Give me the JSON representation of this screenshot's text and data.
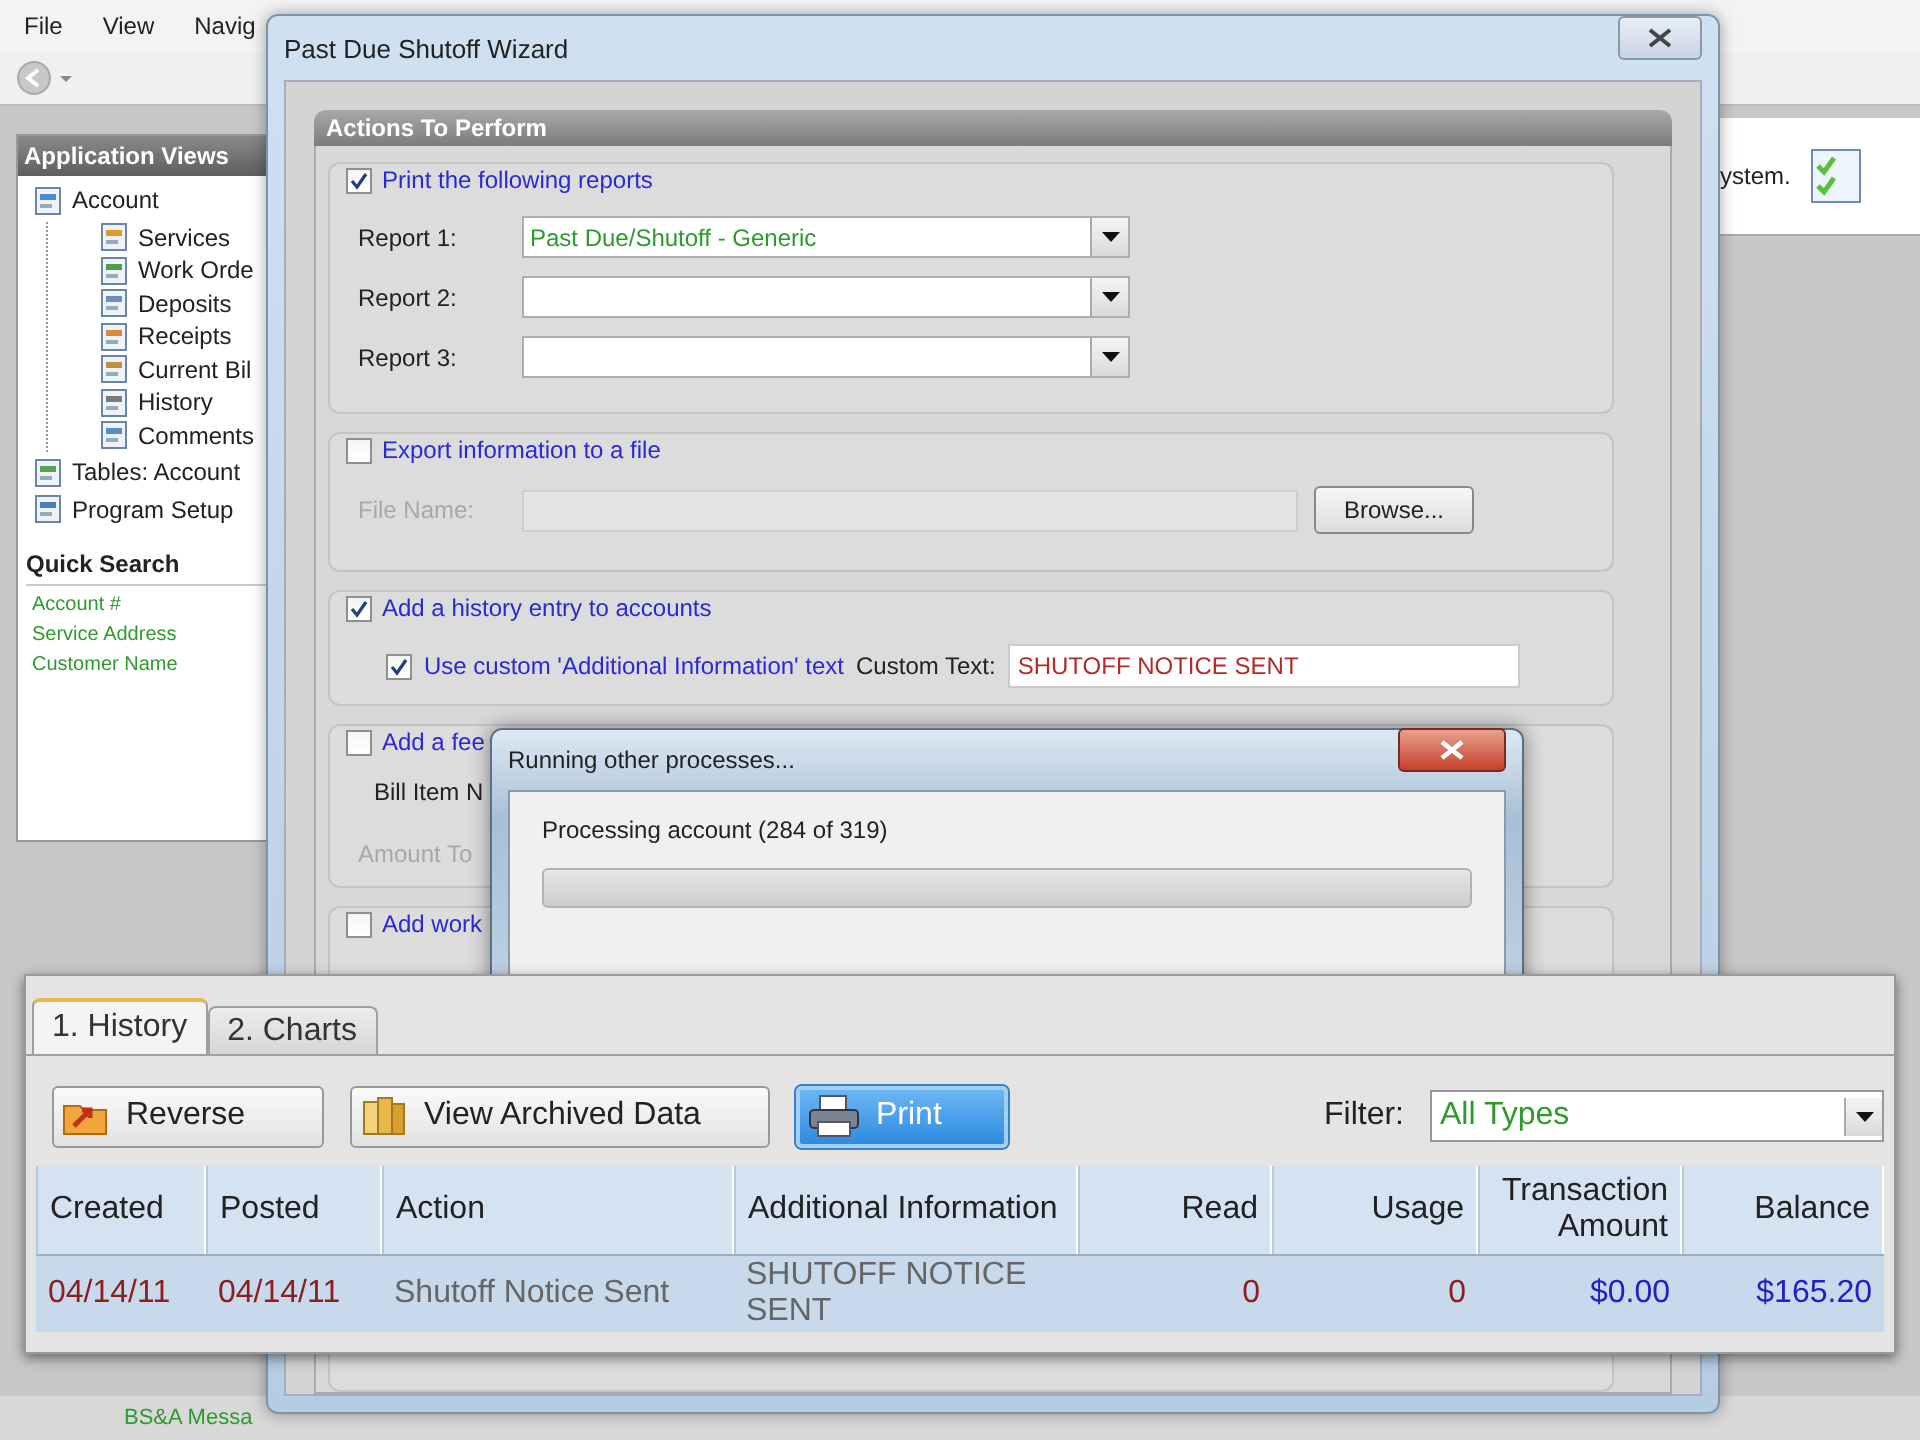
{
  "app": {
    "menu": [
      "File",
      "View",
      "Navig"
    ],
    "sidebar": {
      "title": "Application Views",
      "tree": [
        {
          "label": "Account",
          "children": [
            {
              "label": "Services"
            },
            {
              "label": "Work Orde"
            },
            {
              "label": "Deposits"
            },
            {
              "label": "Receipts"
            },
            {
              "label": "Current Bil"
            },
            {
              "label": "History"
            },
            {
              "label": "Comments"
            }
          ]
        },
        {
          "label": "Tables: Account"
        },
        {
          "label": "Program Setup"
        }
      ]
    },
    "quick_search": {
      "title": "Quick Search",
      "links": [
        "Account #",
        "Service Address",
        "Customer Name"
      ]
    },
    "info_text": "ystem.",
    "status_text": "BS&A Messa"
  },
  "wizard": {
    "title": "Past Due Shutoff Wizard",
    "section": "Actions To Perform",
    "print_group": {
      "label": "Print the following reports",
      "checked": true,
      "reports": [
        {
          "label": "Report 1:",
          "value": "Past Due/Shutoff - Generic"
        },
        {
          "label": "Report 2:"
        },
        {
          "label": "Report 3:"
        }
      ]
    },
    "export_group": {
      "label": "Export information to a file",
      "checked": false,
      "file_label": "File Name:",
      "browse": "Browse..."
    },
    "history_group": {
      "label": "Add a history entry to accounts",
      "checked": true,
      "custom_label": "Use custom 'Additional Information' text",
      "custom_checked": true,
      "custom_text_label": "Custom Text:",
      "custom_text": "SHUTOFF NOTICE SENT"
    },
    "fee_group": {
      "label": "Add a fee",
      "checked": false,
      "bill_item_label": "Bill Item N",
      "amount_label": "Amount To"
    },
    "work_group": {
      "label": "Add work",
      "checked": false
    }
  },
  "progress_dialog": {
    "title": "Running other processes...",
    "message": "Processing account (284 of 319)",
    "level": 0
  },
  "history_panel": {
    "tabs": [
      {
        "label": "1. History",
        "selected": true
      },
      {
        "label": "2. Charts",
        "selected": false
      }
    ],
    "buttons": [
      {
        "label": "Reverse",
        "kind": "reverse",
        "highlighted": false
      },
      {
        "label": "View Archived Data",
        "kind": "archive",
        "highlighted": false
      },
      {
        "label": "Print",
        "kind": "print",
        "highlighted": true
      }
    ],
    "filter_label": "Filter:",
    "filter_value": "All Types",
    "table": {
      "columns": [
        "Created",
        "Posted",
        "Action",
        "Additional Information",
        "Read",
        "Usage",
        "Transaction Amount",
        "Balance"
      ],
      "rows": [
        {
          "selected": true,
          "cells": [
            "04/14/11",
            "04/14/11",
            "Shutoff Notice Sent",
            "SHUTOFF NOTICE SENT",
            "0",
            "0",
            "$0.00",
            "$165.20"
          ]
        }
      ]
    }
  }
}
